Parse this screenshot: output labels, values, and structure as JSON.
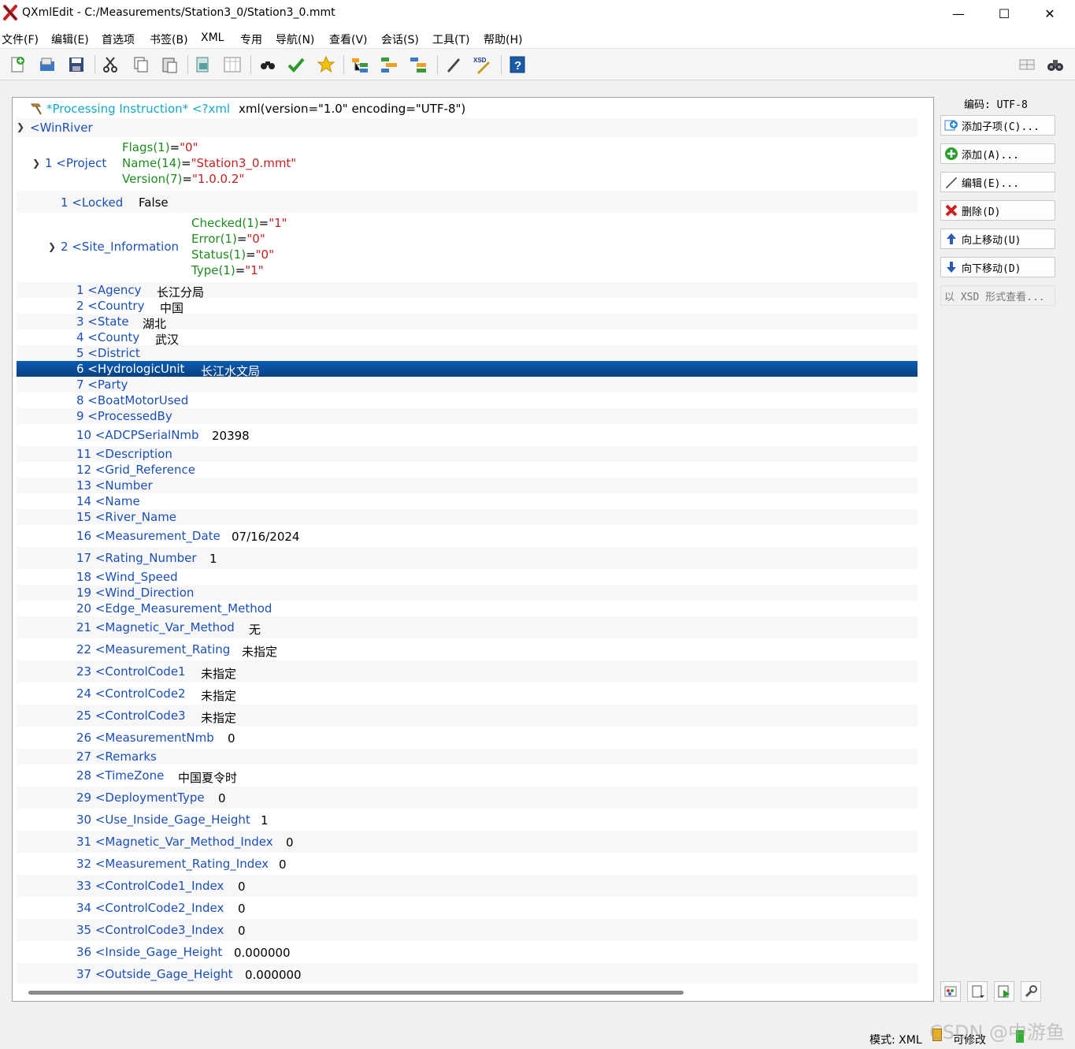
{
  "window": {
    "title": "QXmlEdit - C:/Measurements/Station3_0/Station3_0.mmt",
    "minimize": "—",
    "maximize": "☐",
    "close": "✕"
  },
  "menu": [
    "文件(F)",
    "编辑(E)",
    "首选项",
    "书签(B)",
    "XML",
    "专用",
    "导航(N)",
    "查看(V)",
    "会话(S)",
    "工具(T)",
    "帮助(H)"
  ],
  "pi": {
    "label": "*Processing Instruction* <?xml",
    "value": "xml(version=\"1.0\" encoding=\"UTF-8\")"
  },
  "root": {
    "tag": "<WinRiver"
  },
  "project": {
    "tag": "1 <Project",
    "attrs": [
      {
        "name": "Flags(1)",
        "value": "\"0\""
      },
      {
        "name": "Name(14)",
        "value": "\"Station3_0.mmt\""
      },
      {
        "name": "Version(7)",
        "value": "\"1.0.0.2\""
      }
    ]
  },
  "locked": {
    "tag": "1 <Locked",
    "value": "False"
  },
  "site": {
    "tag": "2 <Site_Information",
    "attrs": [
      {
        "name": "Checked(1)",
        "value": "\"1\""
      },
      {
        "name": "Error(1)",
        "value": "\"0\""
      },
      {
        "name": "Status(1)",
        "value": "\"0\""
      },
      {
        "name": "Type(1)",
        "value": "\"1\""
      }
    ]
  },
  "items": [
    {
      "tag": "1 <Agency",
      "value": "长江分局"
    },
    {
      "tag": "2 <Country",
      "value": "中国"
    },
    {
      "tag": "3 <State",
      "value": "湖北"
    },
    {
      "tag": "4 <County",
      "value": "武汉"
    },
    {
      "tag": "5 <District",
      "value": ""
    },
    {
      "tag": "6 <HydrologicUnit",
      "value": "长江水文局"
    },
    {
      "tag": "7 <Party",
      "value": ""
    },
    {
      "tag": "8 <BoatMotorUsed",
      "value": ""
    },
    {
      "tag": "9 <ProcessedBy",
      "value": ""
    },
    {
      "tag": "10 <ADCPSerialNmb",
      "value": "20398"
    },
    {
      "tag": "11 <Description",
      "value": ""
    },
    {
      "tag": "12 <Grid_Reference",
      "value": ""
    },
    {
      "tag": "13 <Number",
      "value": ""
    },
    {
      "tag": "14 <Name",
      "value": ""
    },
    {
      "tag": "15 <River_Name",
      "value": ""
    },
    {
      "tag": "16 <Measurement_Date",
      "value": "07/16/2024"
    },
    {
      "tag": "17 <Rating_Number",
      "value": "1"
    },
    {
      "tag": "18 <Wind_Speed",
      "value": ""
    },
    {
      "tag": "19 <Wind_Direction",
      "value": ""
    },
    {
      "tag": "20 <Edge_Measurement_Method",
      "value": ""
    },
    {
      "tag": "21 <Magnetic_Var_Method",
      "value": "无"
    },
    {
      "tag": "22 <Measurement_Rating",
      "value": "未指定"
    },
    {
      "tag": "23 <ControlCode1",
      "value": "未指定"
    },
    {
      "tag": "24 <ControlCode2",
      "value": "未指定"
    },
    {
      "tag": "25 <ControlCode3",
      "value": "未指定"
    },
    {
      "tag": "26 <MeasurementNmb",
      "value": "0"
    },
    {
      "tag": "27 <Remarks",
      "value": ""
    },
    {
      "tag": "28 <TimeZone",
      "value": "中国夏令时"
    },
    {
      "tag": "29 <DeploymentType",
      "value": "0"
    },
    {
      "tag": "30 <Use_Inside_Gage_Height",
      "value": "1"
    },
    {
      "tag": "31 <Magnetic_Var_Method_Index",
      "value": "0"
    },
    {
      "tag": "32 <Measurement_Rating_Index",
      "value": "0"
    },
    {
      "tag": "33 <ControlCode1_Index",
      "value": "0"
    },
    {
      "tag": "34 <ControlCode2_Index",
      "value": "0"
    },
    {
      "tag": "35 <ControlCode3_Index",
      "value": "0"
    },
    {
      "tag": "36 <Inside_Gage_Height",
      "value": "0.000000"
    },
    {
      "tag": "37 <Outside_Gage_Height",
      "value": "0.000000"
    }
  ],
  "side": {
    "encoding": "编码: UTF-8",
    "add_child": "添加子项(C)...",
    "add": "添加(A)...",
    "edit": "编辑(E)...",
    "delete": "删除(D)",
    "move_up": "向上移动(U)",
    "move_down": "向下移动(D)",
    "view_xsd": "以 XSD 形式查看..."
  },
  "status": {
    "mode": "模式: XML",
    "editable": "可修改",
    "watermark": "CSDN @中游鱼"
  },
  "colors": {
    "tag": "#1a4fb8",
    "attr_name": "#1d8c1d",
    "attr_value": "#c41f1f",
    "selection": "#0a4c96",
    "pi": "#12a8c8"
  }
}
